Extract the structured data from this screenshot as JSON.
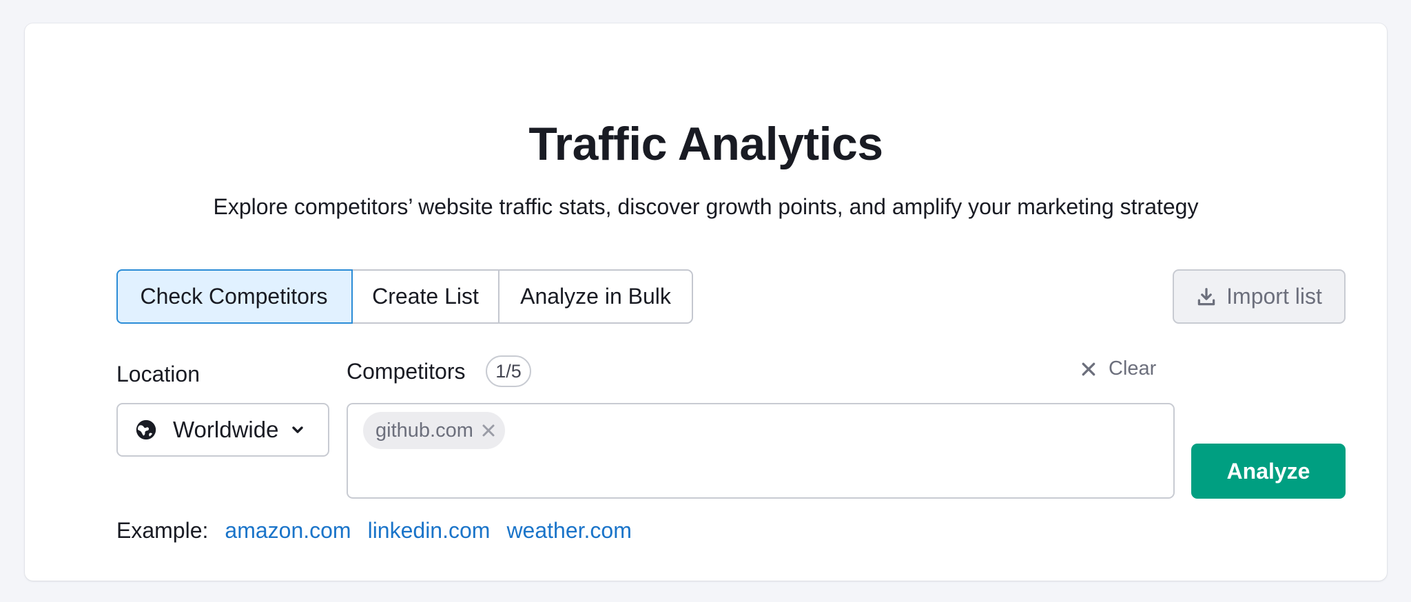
{
  "header": {
    "title": "Traffic Analytics",
    "subtitle": "Explore competitors’ website traffic stats, discover growth points, and amplify your marketing strategy"
  },
  "mode_tabs": [
    {
      "label": "Check Competitors",
      "active": true
    },
    {
      "label": "Create List",
      "active": false
    },
    {
      "label": "Analyze in Bulk",
      "active": false
    }
  ],
  "import_button": {
    "label": "Import list",
    "icon": "download-icon"
  },
  "location": {
    "label": "Location",
    "selected": "Worldwide",
    "icon": "globe-icon"
  },
  "competitors": {
    "label": "Competitors",
    "count_badge": "1/5",
    "clear_label": "Clear",
    "chips": [
      "github.com"
    ]
  },
  "analyze_button": {
    "label": "Analyze"
  },
  "examples": {
    "label": "Example:",
    "links": [
      "amazon.com",
      "linkedin.com",
      "weather.com"
    ]
  },
  "colors": {
    "accent_green": "#009f81",
    "link_blue": "#1a74c9",
    "active_tab_bg": "#e1f1ff",
    "active_tab_border": "#2b8cd6",
    "page_bg": "#f4f5f9"
  }
}
